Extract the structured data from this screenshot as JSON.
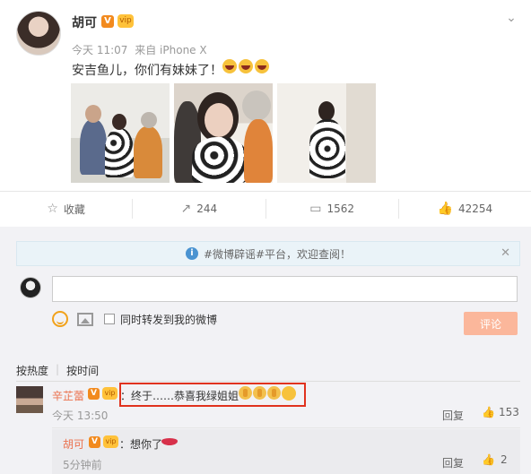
{
  "post": {
    "author": "胡可",
    "verified_badge": "V",
    "vip_badge": "vip",
    "time": "今天 11:07",
    "source": "来自 iPhone X",
    "text": "安吉鱼儿，你们有妹妹了！",
    "emojis": [
      "laughing-emoji",
      "laughing-emoji",
      "laughing-emoji"
    ],
    "photos": [
      "family-photo-1",
      "family-photo-2",
      "family-photo-3"
    ]
  },
  "actions": {
    "favorite": "收藏",
    "reposts": "244",
    "comments": "1562",
    "likes": "42254"
  },
  "comment_box": {
    "notice": "#微博辟谣#平台，欢迎查阅！",
    "input_value": "",
    "repost_label": "同时转发到我的微博",
    "submit_label": "评论"
  },
  "sort": {
    "hot": "按热度",
    "time": "按时间"
  },
  "comments": [
    {
      "user": "辛芷蕾",
      "text": "：终于……恭喜我绿姐姐",
      "time": "今天 13:50",
      "reply_label": "回复",
      "likes": "153"
    }
  ],
  "reply": {
    "user": "胡可",
    "text": "：想你了",
    "time": "5分钟前",
    "reply_label": "回复",
    "likes": "2"
  },
  "colors": {
    "accent_orange": "#eb7350",
    "highlight_box": "#e0321e",
    "submit_bg": "#fbb79b",
    "notice_bg": "#eaf3f8"
  }
}
